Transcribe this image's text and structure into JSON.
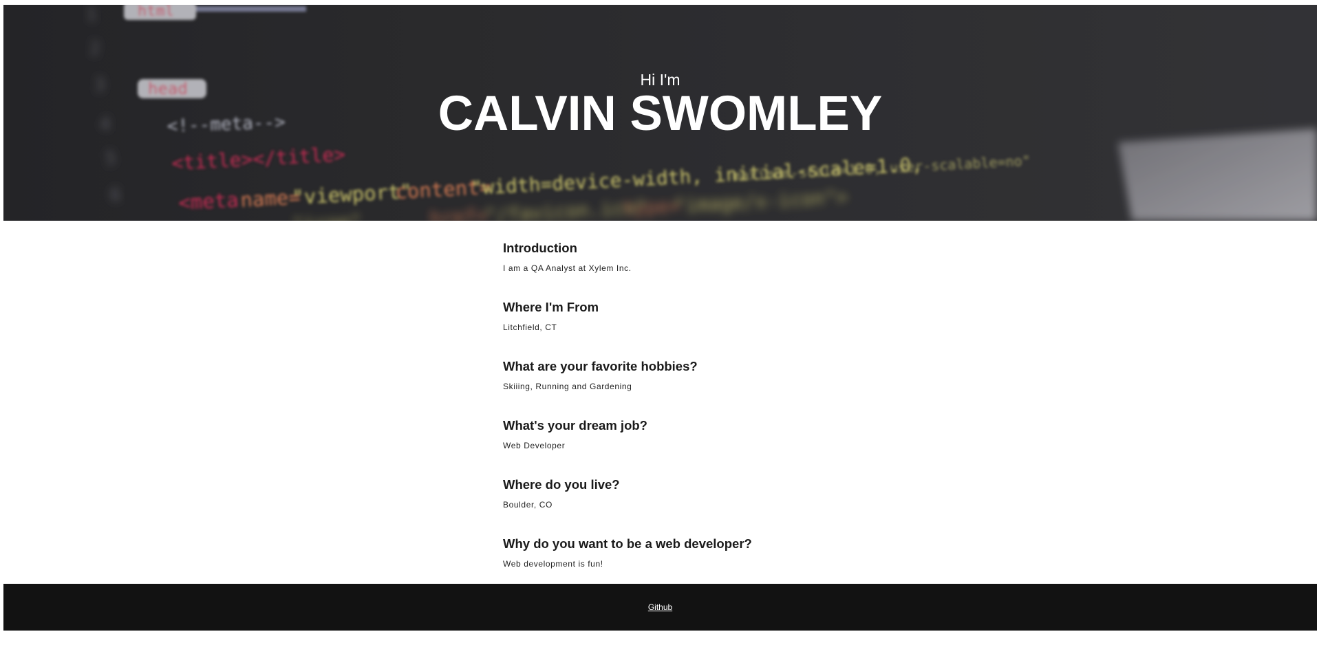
{
  "hero": {
    "greeting": "Hi I'm",
    "name": "CALVIN SWOMLEY"
  },
  "sections": [
    {
      "heading": "Introduction",
      "text": "I am a QA Analyst at Xylem Inc."
    },
    {
      "heading": "Where I'm From",
      "text": "Litchfield, CT"
    },
    {
      "heading": "What are your favorite hobbies?",
      "text": "Skiiing, Running and Gardening"
    },
    {
      "heading": "What's your dream job?",
      "text": "Web Developer"
    },
    {
      "heading": "Where do you live?",
      "text": "Boulder, CO"
    },
    {
      "heading": "Why do you want to be a web developer?",
      "text": "Web development is fun!"
    }
  ],
  "footer": {
    "link_label": "Github"
  },
  "colors": {
    "hero_background": "#2f2f32",
    "footer_background": "#121212",
    "text": "#1a1a1a"
  }
}
